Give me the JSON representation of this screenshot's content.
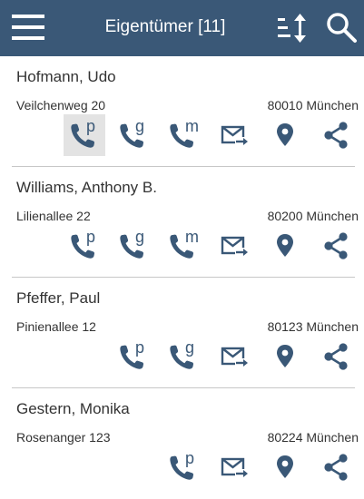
{
  "header": {
    "title": "Eigentümer [11]",
    "menu_icon": "hamburger-menu-icon",
    "sort_icon": "sort-icon",
    "search_icon": "search-icon"
  },
  "colors": {
    "appbar": "#3a5877",
    "icon": "#3a5877",
    "highlight": "#e3e3e3"
  },
  "owners": [
    {
      "name": "Hofmann, Udo",
      "street": "Veilchenweg 20",
      "city": "80010 München",
      "actions": [
        "phone-private",
        "phone-business",
        "phone-mobile",
        "email",
        "location",
        "share"
      ]
    },
    {
      "name": "Williams, Anthony B.",
      "street": "Lilienallee 22",
      "city": "80200 München",
      "actions": [
        "phone-private",
        "phone-business",
        "phone-mobile",
        "email",
        "location",
        "share"
      ]
    },
    {
      "name": "Pfeffer, Paul",
      "street": "Pinienallee 12",
      "city": "80123 München",
      "actions": [
        "phone-private",
        "phone-business",
        "email",
        "location",
        "share"
      ]
    },
    {
      "name": "Gestern, Monika",
      "street": "Rosenanger 123",
      "city": "80224 München",
      "actions": [
        "phone-private",
        "email",
        "location",
        "share"
      ]
    }
  ],
  "phone_letters": {
    "phone-private": "p",
    "phone-business": "g",
    "phone-mobile": "m"
  }
}
